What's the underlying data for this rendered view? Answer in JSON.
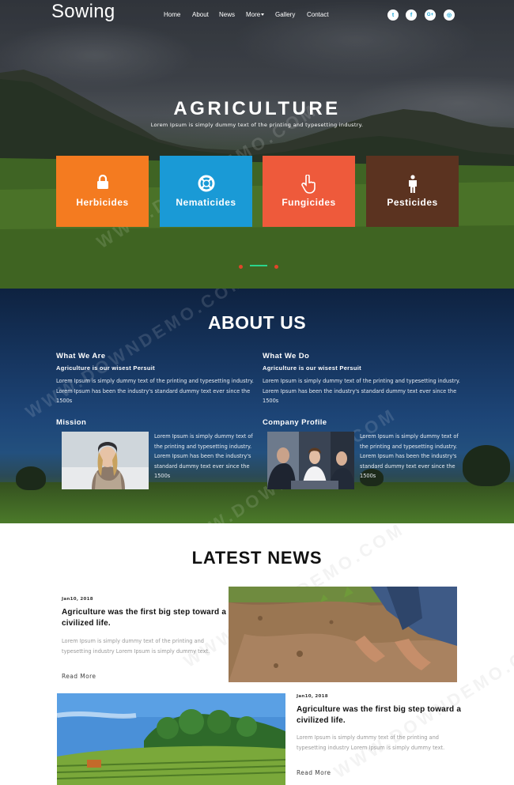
{
  "brand": {
    "logo": "Sowing"
  },
  "nav": {
    "items": [
      "Home",
      "About",
      "News",
      "More",
      "Gallery",
      "Contact"
    ]
  },
  "social": [
    {
      "icon": "twitter-icon",
      "glyph": "t"
    },
    {
      "icon": "facebook-icon",
      "glyph": "f"
    },
    {
      "icon": "google-plus-icon",
      "glyph": "G+"
    },
    {
      "icon": "dribbble-icon",
      "glyph": "◎"
    }
  ],
  "hero": {
    "title": "AGRICULTURE",
    "subtitle": "Lorem Ipsum is simply dummy text of the printing and typesetting industry.",
    "tiles": [
      {
        "label": "Herbicides",
        "icon": "lock-icon",
        "color": "#f47b20"
      },
      {
        "label": "Nematicides",
        "icon": "life-ring-icon",
        "color": "#1a9ad6"
      },
      {
        "label": "Fungicides",
        "icon": "hand-pointer-icon",
        "color": "#ee5a3b"
      },
      {
        "label": "Pesticides",
        "icon": "person-icon",
        "color": "#5b3320"
      }
    ]
  },
  "about": {
    "title": "ABOUT US",
    "what_we_are": {
      "heading": "What We Are",
      "subheading": "Agriculture is our wisest Persuit",
      "text": "Lorem Ipsum is simply dummy text of the printing and typesetting industry. Lorem Ipsum has been the industry's standard dummy text ever since the 1500s"
    },
    "what_we_do": {
      "heading": "What We Do",
      "subheading": "Agriculture is our wisest Persuit",
      "text": "Lorem Ipsum is simply dummy text of the printing and typesetting industry. Lorem Ipsum has been the industry's standard dummy text ever since the 1500s"
    },
    "mission": {
      "heading": "Mission",
      "text": "Lorem Ipsum is simply dummy text of the printing and typesetting industry. Lorem Ipsum has been the industry's standard dummy text ever since the 1500s"
    },
    "company_profile": {
      "heading": "Company Profile",
      "text": "Lorem Ipsum is simply dummy text of the printing and typesetting industry. Lorem Ipsum has been the industry's standard dummy text ever since the 1500s"
    }
  },
  "news": {
    "title": "LATEST NEWS",
    "items": [
      {
        "date": "Jan10, 2018",
        "headline": "Agriculture was the first big step toward a civilized life.",
        "text": "Lorem Ipsum is simply dummy text of the printing and typesetting industry Lorem Ipsum is simply dummy text.",
        "more": "Read More"
      },
      {
        "date": "Jan10, 2018",
        "headline": "Agriculture was the first big step toward a civilized life.",
        "text": "Lorem Ipsum is simply dummy text of the printing and typesetting industry Lorem Ipsum is simply dummy text.",
        "more": "Read More"
      }
    ]
  },
  "watermark": "WWW.DOWNDEMO.COM"
}
